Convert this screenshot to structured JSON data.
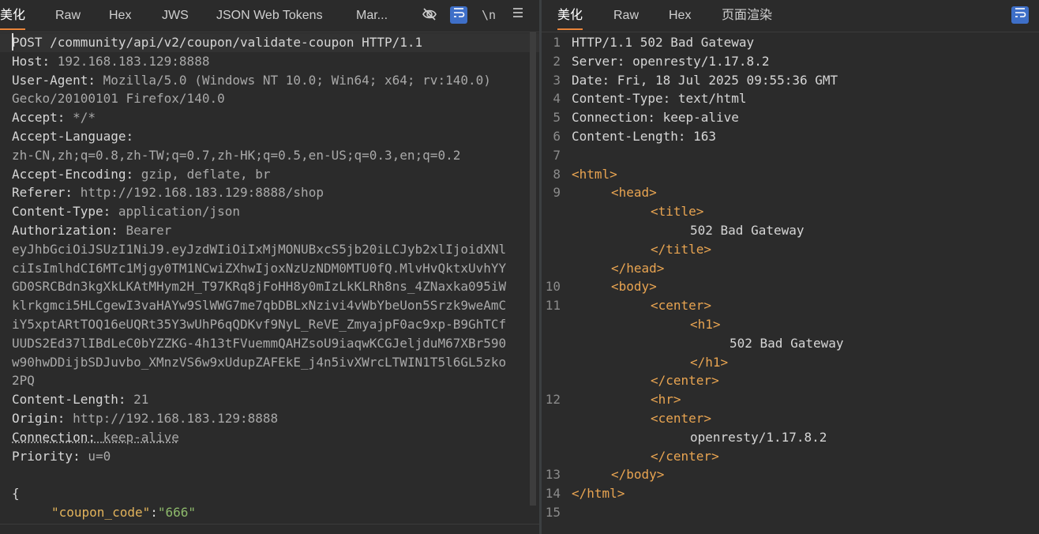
{
  "left": {
    "tabs": [
      "美化",
      "Raw",
      "Hex",
      "JWS",
      "JSON Web Tokens",
      "Mar..."
    ],
    "active_tab": "美化",
    "toolbar": {
      "hide_icon": "eye-slash-icon",
      "wrap_icon": "wrap-lines-icon",
      "newline_label": "\\n",
      "menu_icon": "hamburger-menu-icon"
    },
    "request_lines": [
      {
        "k": "POST /community/api/v2/coupon/validate-coupon HTTP/1.1",
        "v": ""
      },
      {
        "k": "Host: ",
        "v": "192.168.183.129:8888"
      },
      {
        "k": "User-Agent: ",
        "v": "Mozilla/5.0 (Windows NT 10.0; Win64; x64; rv:140.0)"
      },
      {
        "k": "",
        "v": "Gecko/20100101 Firefox/140.0"
      },
      {
        "k": "Accept: ",
        "v": "*/*"
      },
      {
        "k": "Accept-Language: ",
        "v": ""
      },
      {
        "k": "",
        "v": "zh-CN,zh;q=0.8,zh-TW;q=0.7,zh-HK;q=0.5,en-US;q=0.3,en;q=0.2"
      },
      {
        "k": "Accept-Encoding: ",
        "v": "gzip, deflate, br"
      },
      {
        "k": "Referer: ",
        "v": "http://192.168.183.129:8888/shop"
      },
      {
        "k": "Content-Type: ",
        "v": "application/json"
      },
      {
        "k": "Authorization: ",
        "v": "Bearer"
      },
      {
        "k": "",
        "v": "eyJhbGciOiJSUzI1NiJ9.eyJzdWIiOiIxMjMONUBxcS5jb20iLCJyb2xlIjoidXNl"
      },
      {
        "k": "",
        "v": "ciIsImlhdCI6MTc1Mjgy0TM1NCwiZXhwIjoxNzUzNDM0MTU0fQ.MlvHvQktxUvhYY"
      },
      {
        "k": "",
        "v": "GD0SRCBdn3kgXkLKAtMHym2H_T97KRq8jFoHH8y0mIzLkKLRh8ns_4ZNaxka095iW"
      },
      {
        "k": "",
        "v": "klrkgmci5HLCgewI3vaHAYw9SlWWG7me7qbDBLxNzivi4vWbYbeUon5Srzk9weAmC"
      },
      {
        "k": "",
        "v": "iY5xptARtTOQ16eUQRt35Y3wUhP6qQDKvf9NyL_ReVE_ZmyajpF0ac9xp-B9GhTCf"
      },
      {
        "k": "",
        "v": "UUDS2Ed37lIBdLeC0bYZZKG-4h13tFVuemmQAHZsoU9iaqwKCGJeljduM67XBr590"
      },
      {
        "k": "",
        "v": "w90hwDDijbSDJuvbo_XMnzVS6w9xUdupZAFEkE_j4n5ivXWrcLTWIN1T5l6GL5zko"
      },
      {
        "k": "",
        "v": "2PQ"
      },
      {
        "k": "Content-Length: ",
        "v": "21"
      },
      {
        "k": "Origin: ",
        "v": "http://192.168.183.129:8888"
      },
      {
        "k": "Connection: ",
        "v": "keep-alive"
      },
      {
        "k": "Priority: ",
        "v": "u=0"
      },
      {
        "k": "",
        "v": ""
      },
      {
        "k": "{",
        "v": ""
      }
    ],
    "body_key": "\"coupon_code\"",
    "body_colon": ":",
    "body_value": "\"666\"",
    "gutter_visible": "5"
  },
  "right": {
    "tabs": [
      "美化",
      "Raw",
      "Hex",
      "页面渲染"
    ],
    "active_tab": "美化",
    "toolbar": {
      "wrap_icon": "wrap-lines-icon"
    },
    "lines": [
      {
        "n": "1",
        "text": "HTTP/1.1 502 Bad Gateway"
      },
      {
        "n": "2",
        "text": "Server: openresty/1.17.8.2"
      },
      {
        "n": "3",
        "text": "Date: Fri, 18 Jul 2025 09:55:36 GMT"
      },
      {
        "n": "4",
        "text": "Content-Type: text/html"
      },
      {
        "n": "5",
        "text": "Connection: keep-alive"
      },
      {
        "n": "6",
        "text": "Content-Length: 163"
      },
      {
        "n": "7",
        "text": ""
      },
      {
        "n": "8",
        "text": "<html>"
      },
      {
        "n": "9",
        "text": "<head>"
      },
      {
        "n": "",
        "text": "<title>"
      },
      {
        "n": "",
        "text": "502 Bad Gateway"
      },
      {
        "n": "",
        "text": "</title>"
      },
      {
        "n": "",
        "text": "</head>"
      },
      {
        "n": "10",
        "text": "<body>"
      },
      {
        "n": "11",
        "text": "<center>"
      },
      {
        "n": "",
        "text": "<h1>"
      },
      {
        "n": "",
        "text": "502 Bad Gateway"
      },
      {
        "n": "",
        "text": "</h1>"
      },
      {
        "n": "",
        "text": "</center>"
      },
      {
        "n": "12",
        "text": "<hr>"
      },
      {
        "n": "",
        "text": "<center>"
      },
      {
        "n": "",
        "text": "openresty/1.17.8.2"
      },
      {
        "n": "",
        "text": "</center>"
      },
      {
        "n": "13",
        "text": "</body>"
      },
      {
        "n": "14",
        "text": "</html>"
      },
      {
        "n": "15",
        "text": ""
      }
    ]
  },
  "colors": {
    "background": "#2b2b2b",
    "accent_tab": "#e8843a",
    "tag": "#e8a451",
    "json_string": "#e2b35b",
    "wrap_button": "#3e6fc8"
  }
}
